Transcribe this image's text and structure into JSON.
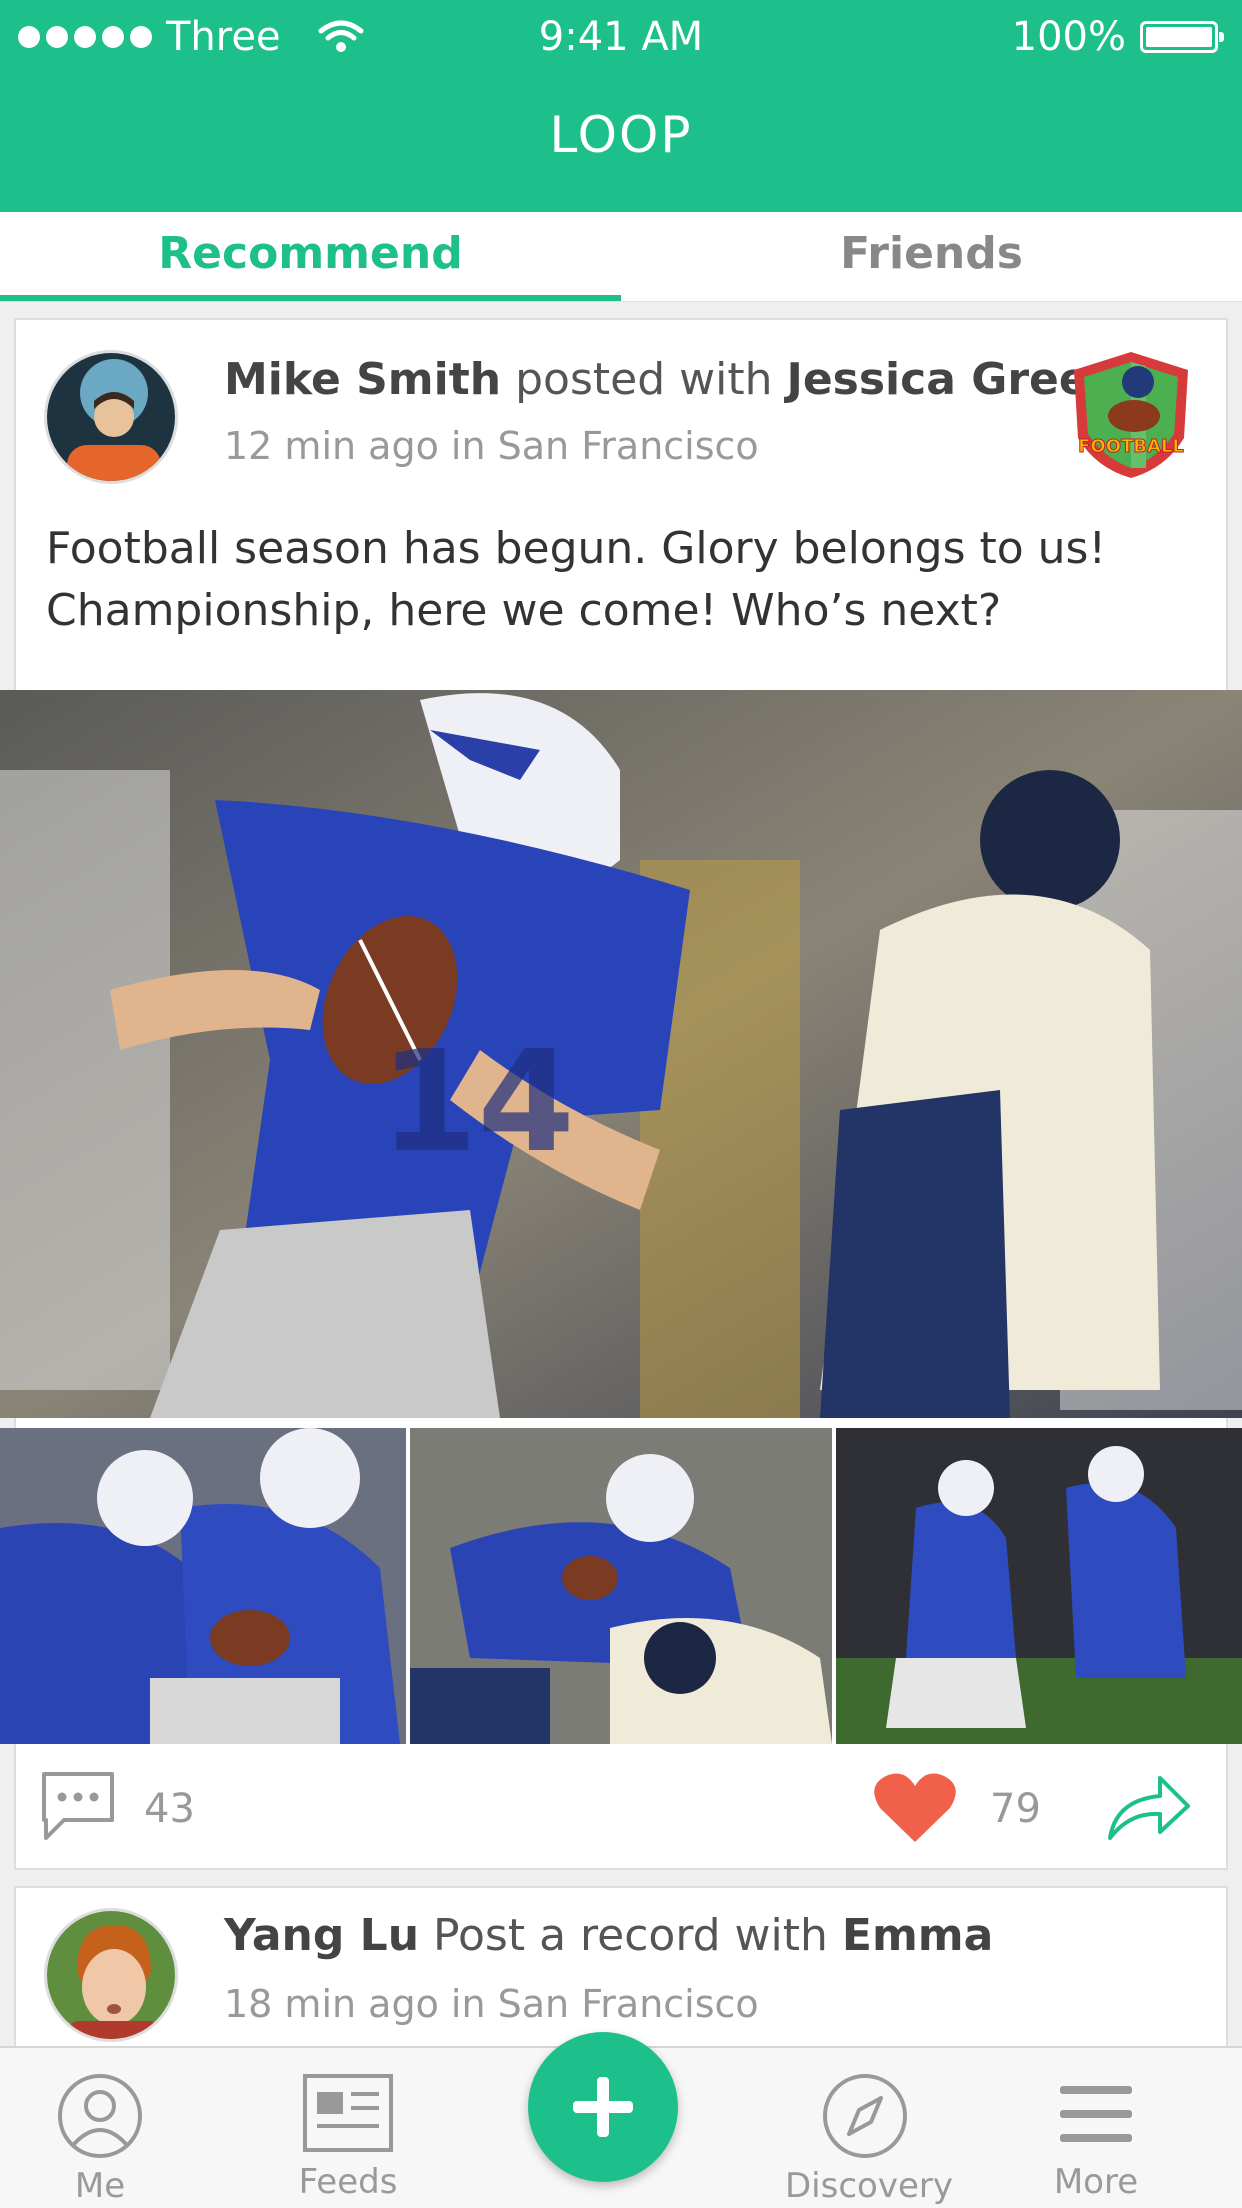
{
  "status_bar": {
    "carrier": "Three",
    "time": "9:41 AM",
    "battery": "100%"
  },
  "header": {
    "title": "LOOP"
  },
  "tabs": [
    {
      "label": "Recommend",
      "active": true
    },
    {
      "label": "Friends",
      "active": false
    }
  ],
  "post1": {
    "author": "Mike Smith",
    "connector": "posted with",
    "tagged": "Jessica Green",
    "meta": "12 min ago in San Francisco",
    "text": "Football season has begun. Glory belongs to us! Championship, here we come! Who’s next?",
    "badge_text": "FOOTBALL",
    "comments": "43",
    "likes": "79"
  },
  "post2": {
    "author": "Yang Lu",
    "connector": "Post a record with",
    "tagged": "Emma",
    "meta": "18 min ago in San Francisco"
  },
  "tabbar": {
    "me": "Me",
    "feeds": "Feeds",
    "discovery": "Discovery",
    "more": "More"
  },
  "colors": {
    "accent": "#1dbf8a",
    "like": "#f0604a"
  }
}
